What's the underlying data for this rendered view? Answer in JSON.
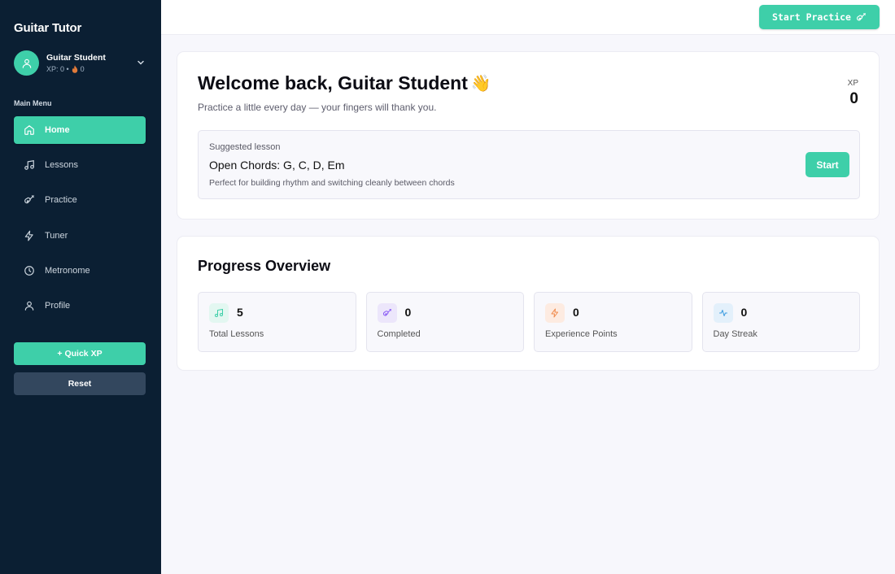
{
  "sidebar": {
    "app_title": "Guitar Tutor",
    "user": {
      "name": "Guitar Student",
      "xp_text": "XP: 0 •",
      "streak_icon": "fire-icon",
      "streak_value": "0"
    },
    "menu_heading": "Main Menu",
    "items": [
      {
        "label": "Home",
        "icon": "home-icon"
      },
      {
        "label": "Lessons",
        "icon": "music-note-icon"
      },
      {
        "label": "Practice",
        "icon": "guitar-icon"
      },
      {
        "label": "Tuner",
        "icon": "lightning-icon"
      },
      {
        "label": "Metronome",
        "icon": "clock-icon"
      },
      {
        "label": "Profile",
        "icon": "user-icon"
      }
    ],
    "active_item": "Home",
    "quick_xp_label": "+ Quick XP",
    "reset_label": "Reset"
  },
  "topbar": {
    "start_practice_label": "Start Practice"
  },
  "welcome": {
    "title": "Welcome back, Guitar Student",
    "emoji": "👋",
    "subtitle": "Practice a little every day — your fingers will thank you.",
    "xp_label": "XP",
    "xp_value": "0",
    "suggested": {
      "kicker": "Suggested lesson",
      "title": "Open Chords: G, C, D, Em",
      "description": "Perfect for building rhythm and switching cleanly between chords",
      "button_label": "Start"
    }
  },
  "progress": {
    "title": "Progress Overview",
    "stats": [
      {
        "value": "5",
        "label": "Total Lessons",
        "icon": "music-note-icon",
        "color": "#3ecfa9",
        "bg": "#e3f7f1"
      },
      {
        "value": "0",
        "label": "Completed",
        "icon": "guitar-icon",
        "color": "#8b5cf6",
        "bg": "#ece6fb"
      },
      {
        "value": "0",
        "label": "Experience Points",
        "icon": "lightning-icon",
        "color": "#f08a4b",
        "bg": "#fdebe1"
      },
      {
        "value": "0",
        "label": "Day Streak",
        "icon": "activity-icon",
        "color": "#3b9be0",
        "bg": "#e3f0fb"
      }
    ]
  },
  "colors": {
    "accent": "#3ecfa9",
    "sidebar_bg": "#0b1f33",
    "reset_bg": "#33475e"
  }
}
